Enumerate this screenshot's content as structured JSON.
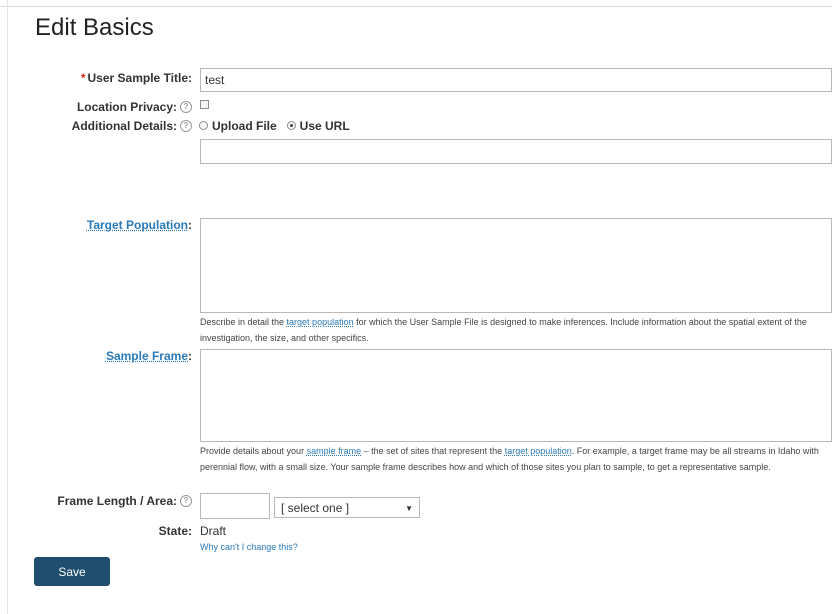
{
  "page": {
    "title": "Edit Basics"
  },
  "fields": {
    "title": {
      "required_mark": "*",
      "label": "User Sample Title:",
      "value": "test"
    },
    "privacy": {
      "label": "Location Privacy:",
      "checked": false
    },
    "details": {
      "label": "Additional Details:",
      "options": [
        "Upload File",
        "Use URL"
      ],
      "selected": "Use URL",
      "url_value": ""
    },
    "target": {
      "label": "Target Population",
      "colon": ":",
      "value": "",
      "help_1": "Describe in detail the ",
      "help_link": "target population",
      "help_2": " for which the User Sample File is designed to make inferences. Include information about the spatial extent of the investigation, the size, and other specifics."
    },
    "frame": {
      "label": "Sample Frame",
      "colon": ":",
      "value": "",
      "help_1": "Provide details about your ",
      "help_link_1": "sample frame",
      "help_2": " – the set of sites that represent the ",
      "help_link_2": "target population",
      "help_3": ". For example, a target frame may be all streams in Idaho with perennial flow, with a small size. Your sample frame describes how and which of those sites you plan to sample, to get a representative sample."
    },
    "length": {
      "label": "Frame Length / Area:",
      "value": "",
      "unit_selected": "[ select one ]"
    },
    "state": {
      "label": "State:",
      "value": "Draft",
      "help_link": "Why can't I change this?"
    }
  },
  "actions": {
    "save_label": "Save"
  },
  "icons": {
    "help": "question-circle-icon",
    "caret": "caret-down-icon"
  },
  "colors": {
    "accent": "#2a7ab8",
    "button": "#1f4e6e",
    "required": "#d9291c"
  }
}
